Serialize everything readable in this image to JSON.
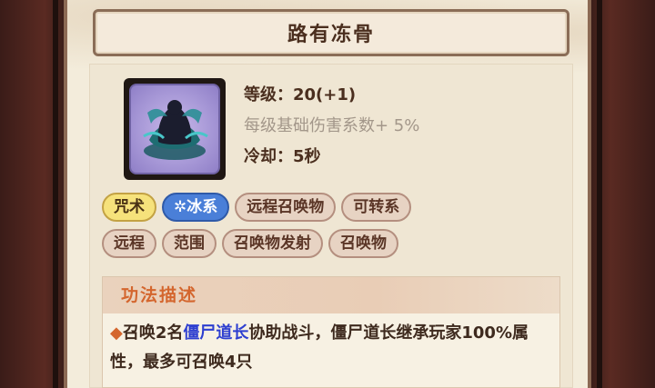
{
  "skill": {
    "name": "路有冻骨",
    "level_label": "等级：",
    "level_value": "20(+1)",
    "scaling_text": "每级基础伤害系数+ 5%",
    "cooldown_label": "冷却：",
    "cooldown_value": "5秒",
    "icon": "summon-ghost-icon"
  },
  "tags": {
    "row1": [
      "咒术",
      "✲冰系",
      "远程召唤物",
      "可转系"
    ],
    "row2": [
      "远程",
      "范围",
      "召唤物发射",
      "召唤物"
    ]
  },
  "description": {
    "header": "功法描述",
    "bullet": "◆",
    "part1": "召唤2名",
    "highlight": "僵尸道长",
    "part2": "协助战斗，僵尸道长继承玩家100%属性，最多可召唤4只"
  },
  "colors": {
    "accent_orange": "#d4662e",
    "highlight_blue": "#2e3fd0",
    "tag_yellow": "#f6e27b",
    "tag_blue": "#4a7fd8"
  }
}
